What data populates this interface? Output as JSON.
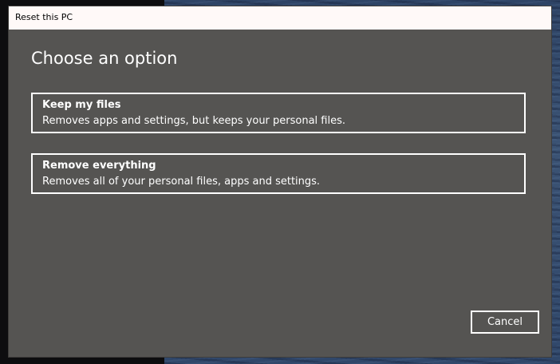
{
  "window": {
    "title": "Reset this PC"
  },
  "main": {
    "heading": "Choose an option",
    "options": [
      {
        "title": "Keep my files",
        "description": "Removes apps and settings, but keeps your personal files."
      },
      {
        "title": "Remove everything",
        "description": "Removes all of your personal files, apps and settings."
      }
    ]
  },
  "footer": {
    "cancel_label": "Cancel"
  },
  "colors": {
    "dialog_background": "#555452",
    "titlebar_background": "#fff9f8",
    "text": "#ffffff"
  }
}
